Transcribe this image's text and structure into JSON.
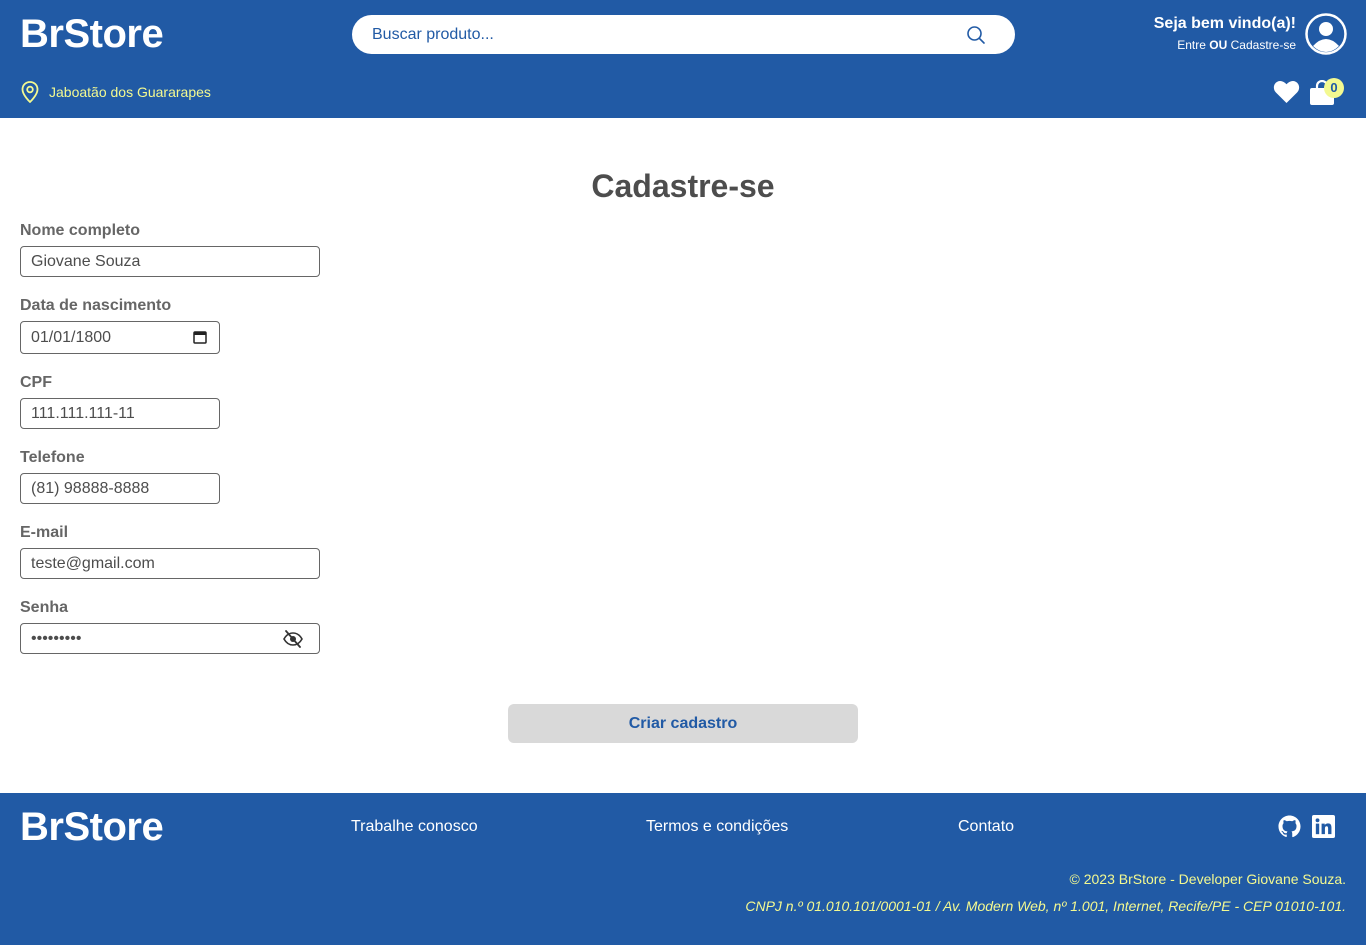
{
  "header": {
    "logo": "BrStore",
    "search_placeholder": "Buscar produto...",
    "welcome_title": "Seja bem vindo(a)!",
    "welcome_login": "Entre",
    "welcome_or": "OU",
    "welcome_signup": "Cadastre-se",
    "location": "Jaboatão dos Guararapes",
    "cart_count": "0"
  },
  "form": {
    "title": "Cadastre-se",
    "name_label": "Nome completo",
    "name_value": "Giovane Souza",
    "birth_label": "Data de nascimento",
    "birth_value": "01/01/1800",
    "cpf_label": "CPF",
    "cpf_value": "111.111.111-11",
    "phone_label": "Telefone",
    "phone_value": "(81) 98888-8888",
    "email_label": "E-mail",
    "email_value": "teste@gmail.com",
    "password_label": "Senha",
    "password_value": "123456789",
    "submit_label": "Criar cadastro"
  },
  "footer": {
    "logo": "BrStore",
    "links": [
      "Trabalhe conosco",
      "Termos e condições",
      "Contato"
    ],
    "copyright": "© 2023 BrStore - Developer Giovane Souza.",
    "cnpj": "CNPJ n.º 01.010.101/0001-01 / Av. Modern Web, nº 1.001, Internet, Recife/PE - CEP 01010-101."
  },
  "colors": {
    "brand": "#215aa5",
    "accent": "#f3f991",
    "text": "#4d4d4d",
    "label": "#666666",
    "button_bg": "#d9d9d9"
  },
  "icons": [
    "search-icon",
    "user-avatar-icon",
    "location-pin-icon",
    "heart-icon",
    "shopping-bag-icon",
    "calendar-icon",
    "eye-off-icon",
    "github-icon",
    "linkedin-icon"
  ]
}
